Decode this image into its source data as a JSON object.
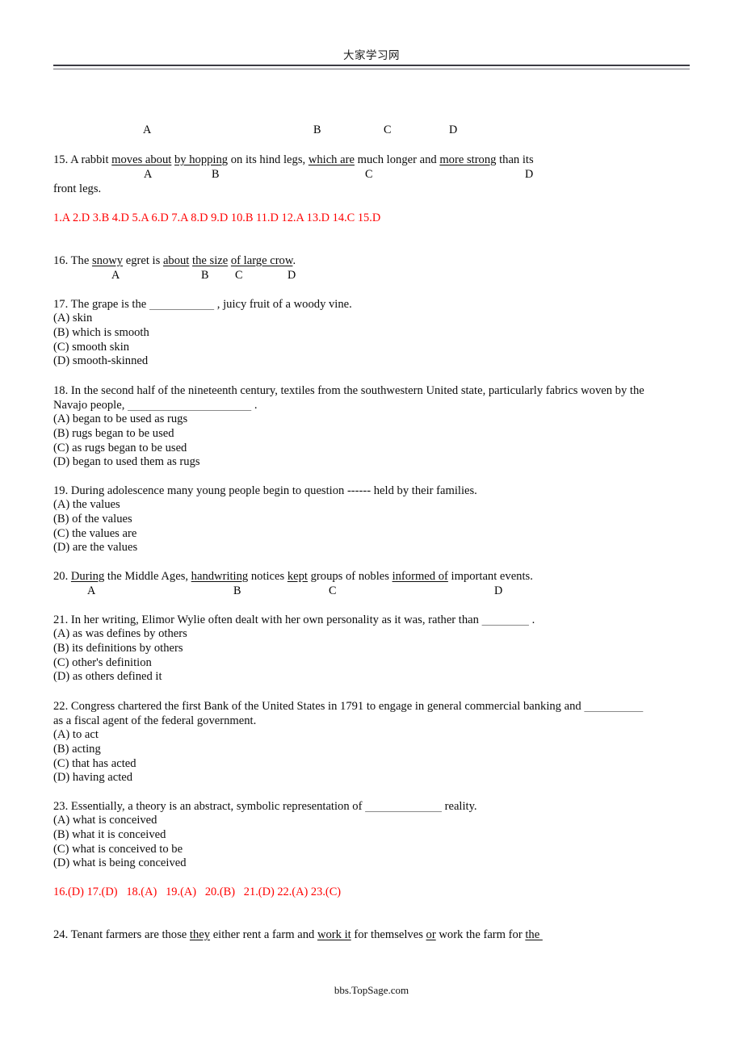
{
  "document": {
    "header_title": "大家学习网",
    "footer_text": "bbs.TopSage.com"
  },
  "orphan_markers": {
    "name": "marker-row-question-14",
    "labels": [
      "A",
      "B",
      "C",
      "D"
    ]
  },
  "questions": [
    {
      "number": "15",
      "type": "error-identification",
      "line1_pre": "15. A rabbit ",
      "u1": "moves about",
      "mid1": " ",
      "u2": "by hopping",
      "mid2": " on its hind legs, ",
      "u3": "which are",
      "mid3": " much longer and ",
      "u4": "more strong",
      "line1_post": " than its",
      "line2": "front legs.",
      "markers": [
        "A",
        "B",
        "C",
        "D"
      ]
    },
    {
      "number": "16",
      "type": "error-identification",
      "line1_pre": "16. The ",
      "u1": "snowy",
      "mid1": " egret is ",
      "u2": "about",
      "mid2": " ",
      "u3": "the size",
      "mid3": " ",
      "u4": "of large crow",
      "line1_post": ".",
      "markers": [
        "A",
        "B",
        "C",
        "D"
      ]
    },
    {
      "number": "17",
      "type": "multiple-choice",
      "stem_pre": "17. The grape is the ",
      "blank": "___________",
      "stem_post": " , juicy fruit of a woody vine.",
      "options": [
        "(A) skin",
        "(B) which is smooth",
        "(C) smooth skin",
        "(D) smooth-skinned"
      ]
    },
    {
      "number": "18",
      "type": "multiple-choice",
      "stem_line1": "18. In the second half of the nineteenth century, textiles from the southwestern United state, particularly fabrics woven by the",
      "stem_pre": "Navajo people, ",
      "blank": "_____________________",
      "stem_post": " .",
      "options": [
        "(A) began to be used as rugs",
        "(B) rugs began to be used",
        "(C) as rugs began to be used",
        "(D) began to used them as rugs"
      ]
    },
    {
      "number": "19",
      "type": "multiple-choice",
      "stem_pre": "19. During adolescence many young people begin to question ------ held by their families.",
      "options": [
        "(A) the values",
        "(B) of the values",
        "(C) the values are",
        "(D) are the values"
      ]
    },
    {
      "number": "20",
      "type": "error-identification",
      "line1_pre": "20. ",
      "u1": "During",
      "mid1": " the Middle Ages, ",
      "u2": "handwriting",
      "mid2": " notices ",
      "u3": "kept",
      "mid3": " groups of nobles ",
      "u4": "informed of",
      "line1_post": " important events.",
      "markers": [
        "A",
        "B",
        "C",
        "D"
      ]
    },
    {
      "number": "21",
      "type": "multiple-choice",
      "stem_pre": "21. In her writing, Elimor Wylie often dealt with her own personality as it was, rather than ",
      "blank": "________",
      "stem_post": " .",
      "options": [
        "(A) as was defines by others",
        "(B) its definitions by others",
        "(C) other's definition",
        "(D) as others defined it"
      ]
    },
    {
      "number": "22",
      "type": "multiple-choice",
      "stem_line1_pre": "22. Congress chartered the first Bank of the United States in 1791 to engage in general commercial banking and ",
      "blank": "__________",
      "stem_line2": "as a fiscal agent of the federal government.",
      "options": [
        "(A) to act",
        "(B) acting",
        "(C) that has acted",
        "(D) having acted"
      ]
    },
    {
      "number": "23",
      "type": "multiple-choice",
      "stem_pre": "23. Essentially, a theory is an abstract, symbolic representation of ",
      "blank": "_____________",
      "stem_post": " reality.",
      "options": [
        "(A) what is conceived",
        "(B) what it is conceived",
        "(C) what is conceived to be",
        "(D) what is being conceived"
      ]
    },
    {
      "number": "24",
      "type": "error-identification",
      "line1_pre": "24. Tenant farmers are those ",
      "u1": "they",
      "mid1": " either rent a farm and ",
      "u2": "work it",
      "mid2": " for themselves ",
      "u3": "or",
      "mid3": " work the farm for ",
      "u4": "the ",
      "line1_post": ""
    }
  ],
  "answer_keys": [
    {
      "name": "answer-key-1-15",
      "text": "1.A 2.D 3.B 4.D 5.A 6.D 7.A 8.D 9.D 10.B 11.D 12.A 13.D 14.C 15.D",
      "color": "#ff0000"
    },
    {
      "name": "answer-key-16-23",
      "text": "16.(D) 17.(D)   18.(A)   19.(A)   20.(B)   21.(D) 22.(A) 23.(C)",
      "color": "#ff0000"
    }
  ]
}
